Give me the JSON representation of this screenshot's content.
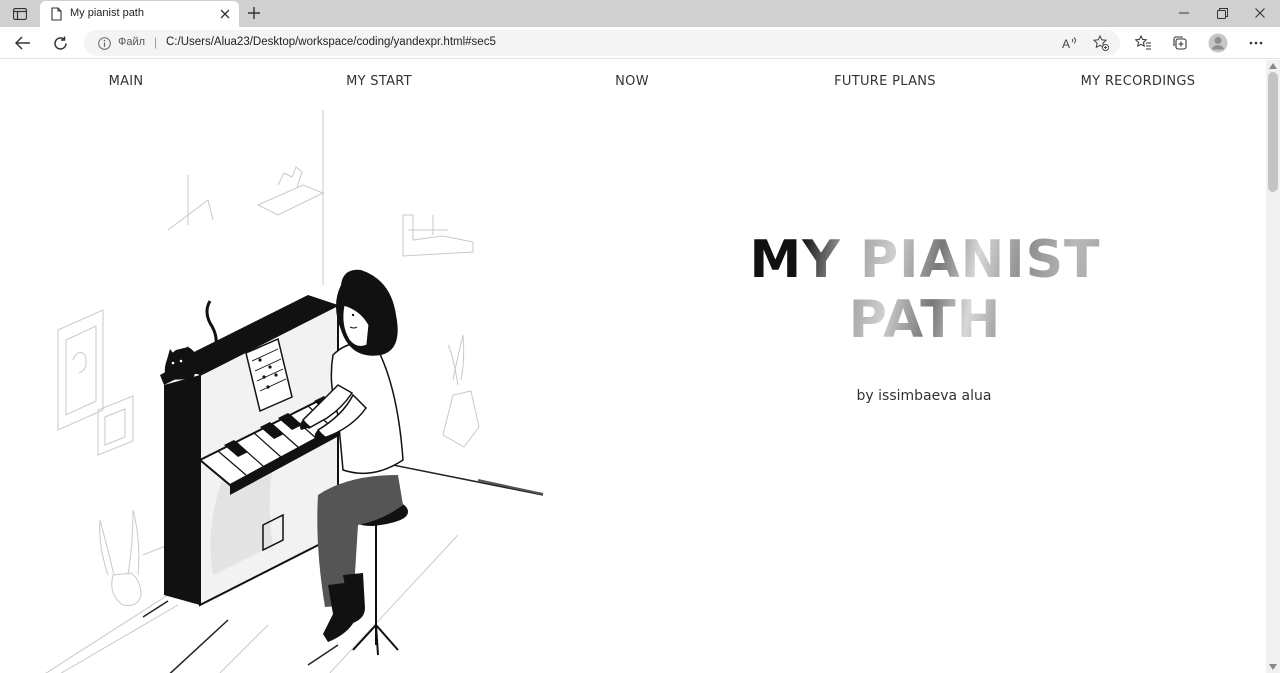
{
  "browser": {
    "tab_title": "My pianist path",
    "address_label": "Файл",
    "address_separator": "|",
    "url": "C:/Users/Alua23/Desktop/workspace/coding/yandexpr.html#sec5"
  },
  "nav": {
    "items": [
      {
        "label": "MAIN"
      },
      {
        "label": "MY START"
      },
      {
        "label": "NOW"
      },
      {
        "label": "FUTURE PLANS"
      },
      {
        "label": "MY RECORDINGS"
      }
    ]
  },
  "hero": {
    "title_line1": "MY PIANIST",
    "title_line2": "PATH",
    "subtitle": "by issimbaeva alua"
  }
}
